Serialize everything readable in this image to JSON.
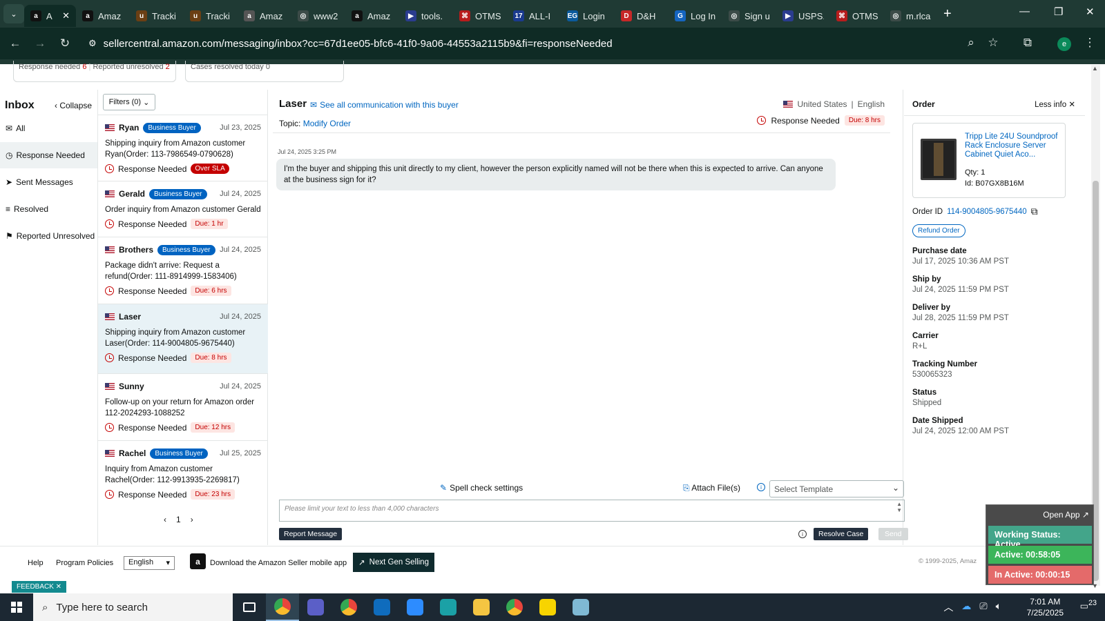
{
  "browser": {
    "tabs": [
      {
        "label": "A",
        "icon": "amazon-icon",
        "color": "#111111",
        "glyph": "a"
      },
      {
        "label": "Amaz",
        "icon": "amazon-icon",
        "color": "#111111",
        "glyph": "a"
      },
      {
        "label": "Tracki",
        "icon": "ups-icon",
        "color": "#6b3f14",
        "glyph": "u"
      },
      {
        "label": "Tracki",
        "icon": "ups-icon",
        "color": "#6b3f14",
        "glyph": "u"
      },
      {
        "label": "Amaz",
        "icon": "amazon-icon",
        "color": "#555555",
        "glyph": "a"
      },
      {
        "label": "www2",
        "icon": "globe-icon",
        "color": "#3c4b48",
        "glyph": "◎"
      },
      {
        "label": "Amaz",
        "icon": "amazon-icon",
        "color": "#111111",
        "glyph": "a"
      },
      {
        "label": "tools.",
        "icon": "usps-icon",
        "color": "#2a3c8f",
        "glyph": "▶"
      },
      {
        "label": "OTMS",
        "icon": "otms-icon",
        "color": "#b71c1c",
        "glyph": "⌘"
      },
      {
        "label": "ALL-I",
        "icon": "allin-icon",
        "color": "#1a3a8f",
        "glyph": "17"
      },
      {
        "label": "Login",
        "icon": "eg-icon",
        "color": "#0b5a9c",
        "glyph": "EG"
      },
      {
        "label": "D&H",
        "icon": "dh-icon",
        "color": "#c62828",
        "glyph": "D"
      },
      {
        "label": "Log In",
        "icon": "g-icon",
        "color": "#1565c0",
        "glyph": "G"
      },
      {
        "label": "Sign u",
        "icon": "globe-icon",
        "color": "#3c4b48",
        "glyph": "◎"
      },
      {
        "label": "USPS.",
        "icon": "usps-icon",
        "color": "#2a3c8f",
        "glyph": "▶"
      },
      {
        "label": "OTMS",
        "icon": "otms-icon",
        "color": "#b71c1c",
        "glyph": "⌘"
      },
      {
        "label": "m.rlca",
        "icon": "globe-icon",
        "color": "#3c4b48",
        "glyph": "◎"
      }
    ],
    "url": "sellercentral.amazon.com/messaging/inbox?cc=67d1ee05-bfc6-41f0-9a06-44553a2115b9&fi=responseNeeded",
    "profile_initial": "e"
  },
  "stats": {
    "response_needed_label": "Response needed",
    "response_needed_count": "6",
    "reported_unresolved_label": "Reported unresolved",
    "reported_unresolved_count": "2",
    "cases_resolved_label": "Cases resolved today",
    "cases_resolved_count": "0"
  },
  "sidebar": {
    "title": "Inbox",
    "collapse": "Collapse",
    "items": [
      {
        "label": "All",
        "icon": "mail-icon",
        "glyph": "✉"
      },
      {
        "label": "Response Needed",
        "icon": "clock-icon",
        "glyph": "◷"
      },
      {
        "label": "Sent Messages",
        "icon": "send-icon",
        "glyph": "➤"
      },
      {
        "label": "Resolved",
        "icon": "resolved-icon",
        "glyph": "≡"
      },
      {
        "label": "Reported Unresolved",
        "icon": "reported-icon",
        "glyph": "⚑"
      }
    ]
  },
  "list": {
    "filters": "Filters (0)",
    "page": "1",
    "business_badge": "Business Buyer",
    "cards": [
      {
        "name": "Ryan",
        "business": true,
        "date": "Jul 23, 2025",
        "subject": "Shipping inquiry from Amazon customer Ryan(Order: 113-7986549-0790628)",
        "status": "Response Needed",
        "due": "Over SLA"
      },
      {
        "name": "Gerald",
        "business": true,
        "date": "Jul 24, 2025",
        "subject": "Order inquiry from Amazon customer Gerald",
        "status": "Response Needed",
        "due": "Due: 1 hr"
      },
      {
        "name": "Brothers",
        "business": true,
        "date": "Jul 24, 2025",
        "subject": "Package didn't arrive: Request a refund(Order: 111-8914999-1583406)",
        "status": "Response Needed",
        "due": "Due: 6 hrs"
      },
      {
        "name": "Laser",
        "business": false,
        "date": "Jul 24, 2025",
        "subject": "Shipping inquiry from Amazon customer Laser(Order: 114-9004805-9675440)",
        "status": "Response Needed",
        "due": "Due: 8 hrs"
      },
      {
        "name": "Sunny",
        "business": false,
        "date": "Jul 24, 2025",
        "subject": "Follow-up on your return for Amazon order 112-2024293-1088252",
        "status": "Response Needed",
        "due": "Due: 12 hrs"
      },
      {
        "name": "Rachel",
        "business": true,
        "date": "Jul 25, 2025",
        "subject": "Inquiry from Amazon customer Rachel(Order: 112-9913935-2269817)",
        "status": "Response Needed",
        "due": "Due: 23 hrs"
      }
    ]
  },
  "conversation": {
    "buyer": "Laser",
    "see_all": "See all communication with this buyer",
    "topic_label": "Topic:",
    "topic": "Modify Order",
    "country": "United States",
    "language": "English",
    "status": "Response Needed",
    "due": "Due: 8 hrs",
    "timestamp": "Jul 24, 2025 3:25 PM",
    "message": "I'm the buyer and shipping this unit directly to my client, however the person explicitly named will not be there when this is expected to arrive. Can anyone at the business sign for it?",
    "spell_check": "Spell check settings",
    "attach": "Attach File(s)",
    "template_placeholder": "Select Template",
    "reply_placeholder": "Please limit your text to less than 4,000 characters",
    "report": "Report Message",
    "resolve": "Resolve Case",
    "send": "Send"
  },
  "order": {
    "title": "Order",
    "less_info": "Less info",
    "product_title": "Tripp Lite 24U Soundproof Rack Enclosure Server Cabinet Quiet Aco...",
    "qty": "Qty: 1",
    "id": "Id: B07GX8B16M",
    "order_id_label": "Order ID",
    "order_id": "114-9004805-9675440",
    "refund": "Refund Order",
    "fields": [
      {
        "label": "Purchase date",
        "value": "Jul 17, 2025 10:36 AM PST"
      },
      {
        "label": "Ship by",
        "value": "Jul 24, 2025 11:59 PM PST"
      },
      {
        "label": "Deliver by",
        "value": "Jul 28, 2025 11:59 PM PST"
      },
      {
        "label": "Carrier",
        "value": "R+L"
      },
      {
        "label": "Tracking Number",
        "value": "530065323"
      },
      {
        "label": "Status",
        "value": "Shipped"
      },
      {
        "label": "Date Shipped",
        "value": "Jul 24, 2025 12:00 AM PST"
      }
    ]
  },
  "footer": {
    "help": "Help",
    "policies": "Program Policies",
    "language": "English",
    "app": "Download the Amazon Seller mobile app",
    "next_gen": "Next Gen Selling",
    "copyright": "© 1999-2025, Amaz",
    "feedback": "FEEDBACK"
  },
  "widget": {
    "open_app": "Open App ↗",
    "working": "Working Status: Active",
    "active": "Active: 00:58:05",
    "inactive": "In Active: 00:00:15",
    "colors": {
      "working": "#43a58a",
      "active": "#3cb55a",
      "inactive": "#e46a6a"
    }
  },
  "taskbar": {
    "search_placeholder": "Type here to search",
    "time": "7:01 AM",
    "date": "7/25/2025",
    "notifications": "23",
    "apps": [
      {
        "icon": "chrome-icon",
        "color": "#e8453c",
        "active": true
      },
      {
        "icon": "teams-icon",
        "color": "#5b5fc7",
        "active": false
      },
      {
        "icon": "chrome-profile-icon",
        "color": "#e8453c",
        "active": false
      },
      {
        "icon": "outlook-icon",
        "color": "#0f6cbd",
        "active": false
      },
      {
        "icon": "zoom-icon",
        "color": "#2d8cff",
        "active": false
      },
      {
        "icon": "app-diamond-icon",
        "color": "#1ba1a6",
        "active": false
      },
      {
        "icon": "file-explorer-icon",
        "color": "#f4c542",
        "active": false
      },
      {
        "icon": "chrome-alt-icon",
        "color": "#e8453c",
        "active": false
      },
      {
        "icon": "sticky-notes-icon",
        "color": "#f7d400",
        "active": false
      },
      {
        "icon": "notes-app-icon",
        "color": "#7fb9d4",
        "active": false
      }
    ]
  }
}
